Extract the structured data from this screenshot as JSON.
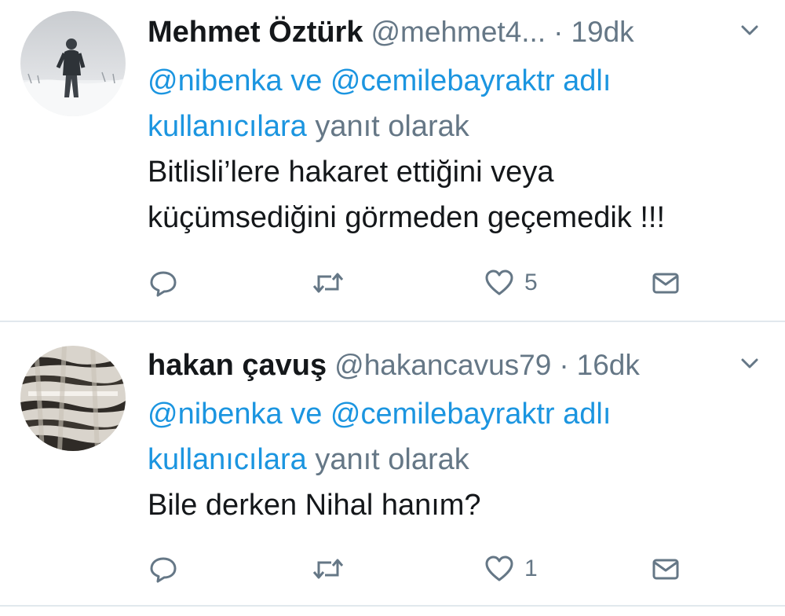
{
  "tweets": [
    {
      "author_name": "Mehmet Öztürk",
      "handle": "@mehmet4...",
      "dot": "·",
      "time": "19dk",
      "reply_mentions": "@nibenka ve @cemilebayraktr adlı",
      "reply_mentions_2": "kullanıcılara",
      "reply_tail": " yanıt olarak",
      "body_lines": [
        "Bitlisli’lere hakaret ettiğini veya",
        "küçümsediğini görmeden geçemedik !!!"
      ],
      "like_count": "5",
      "avatar": "person-in-snow-photo"
    },
    {
      "author_name": "hakan çavuş",
      "handle": "@hakancavus79",
      "dot": "·",
      "time": "16dk",
      "reply_mentions": "@nibenka ve @cemilebayraktr adlı",
      "reply_mentions_2": "kullanıcılara",
      "reply_tail": " yanıt olarak",
      "body_lines": [
        "Bile derken Nihal hanım?"
      ],
      "like_count": "1",
      "avatar": "zebra-stripe-pattern-photo"
    }
  ],
  "icons": {
    "reply": "reply-icon",
    "retweet": "retweet-icon",
    "like": "heart-icon",
    "dm": "envelope-icon",
    "caret": "chevron-down-icon"
  },
  "colors": {
    "mention": "#1b95e0",
    "secondary": "#657786",
    "text": "#14171a",
    "divider": "#e1e8ed"
  }
}
